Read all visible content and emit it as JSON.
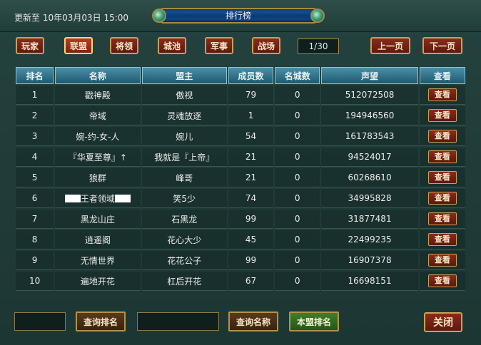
{
  "header": {
    "updated_text": "更新至 10年03月03日 15:00",
    "title": "排行榜"
  },
  "tabs": [
    {
      "label": "玩家",
      "active": false
    },
    {
      "label": "联盟",
      "active": true
    },
    {
      "label": "将领",
      "active": false
    },
    {
      "label": "城池",
      "active": false
    },
    {
      "label": "军事",
      "active": false
    },
    {
      "label": "战场",
      "active": false
    }
  ],
  "pager": {
    "page": "1/30",
    "prev_label": "上一页",
    "next_label": "下一页"
  },
  "table": {
    "columns": [
      "排名",
      "名称",
      "盟主",
      "成员数",
      "名城数",
      "声望",
      "查看"
    ],
    "view_label": "查看",
    "rows": [
      {
        "rank": "1",
        "name": "戳神殿",
        "leader": "傲视",
        "members": "79",
        "cities": "0",
        "prestige": "512072508"
      },
      {
        "rank": "2",
        "name": "帝域",
        "leader": "灵魂放逐",
        "members": "1",
        "cities": "0",
        "prestige": "194946560"
      },
      {
        "rank": "3",
        "name": "婉-约-女-人",
        "leader": "婉儿",
        "members": "54",
        "cities": "0",
        "prestige": "161783543"
      },
      {
        "rank": "4",
        "name": "『华夏至尊』↑",
        "leader": "我就是『上帝』",
        "members": "21",
        "cities": "0",
        "prestige": "94524017"
      },
      {
        "rank": "5",
        "name": "狼群",
        "leader": "峰哥",
        "members": "21",
        "cities": "0",
        "prestige": "60268610"
      },
      {
        "rank": "6",
        "name": "王者领域",
        "leader": "笑5少",
        "members": "74",
        "cities": "0",
        "prestige": "34995828"
      },
      {
        "rank": "7",
        "name": "黑龙山庄",
        "leader": "石黑龙",
        "members": "99",
        "cities": "0",
        "prestige": "31877481"
      },
      {
        "rank": "8",
        "name": "逍遥阁",
        "leader": "花心大少",
        "members": "45",
        "cities": "0",
        "prestige": "22499235"
      },
      {
        "rank": "9",
        "name": "无情世界",
        "leader": "花花公子",
        "members": "99",
        "cities": "0",
        "prestige": "16907378"
      },
      {
        "rank": "10",
        "name": "遍地开花",
        "leader": "杠后开花",
        "members": "67",
        "cities": "0",
        "prestige": "16698151"
      }
    ]
  },
  "footer": {
    "rank_query_label": "查询排名",
    "name_query_label": "查询名称",
    "own_rank_label": "本盟排名",
    "close_label": "关闭"
  }
}
